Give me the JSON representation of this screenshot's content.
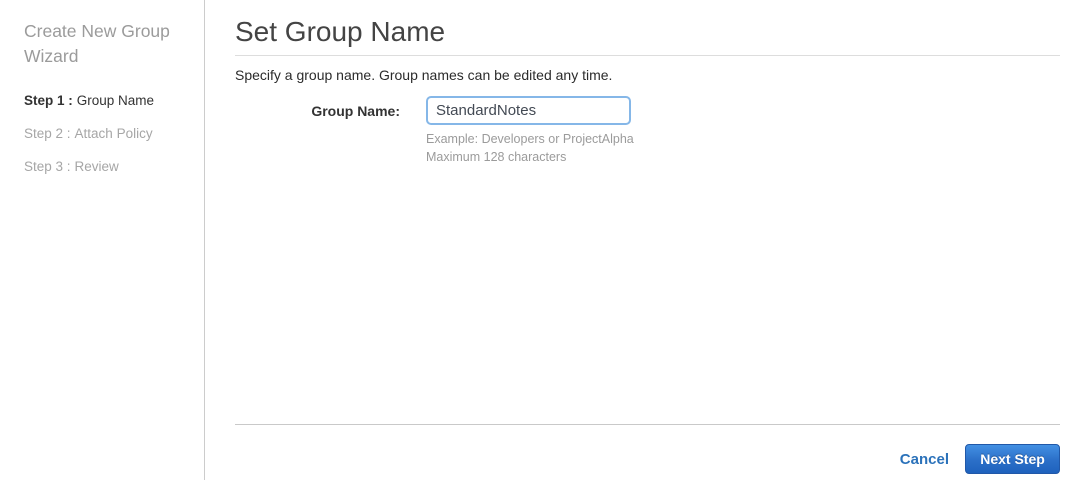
{
  "sidebar": {
    "title": "Create New Group Wizard",
    "steps": [
      {
        "prefix": "Step 1 :",
        "label": "Group Name",
        "active": true
      },
      {
        "prefix": "Step 2 :",
        "label": "Attach Policy",
        "active": false
      },
      {
        "prefix": "Step 3 :",
        "label": "Review",
        "active": false
      }
    ]
  },
  "main": {
    "title": "Set Group Name",
    "subtitle": "Specify a group name. Group names can be edited any time.",
    "form": {
      "group_name_label": "Group Name:",
      "group_name_value": "StandardNotes",
      "helper_line1": "Example: Developers or ProjectAlpha",
      "helper_line2": "Maximum 128 characters"
    },
    "footer": {
      "cancel_label": "Cancel",
      "next_label": "Next Step"
    }
  },
  "colors": {
    "accent_blue": "#2b72ba",
    "button_gradient_top": "#4390e3",
    "button_gradient_bottom": "#1f62bd",
    "input_focus_border": "#85b7e8",
    "muted_gray": "#9b9b9b",
    "heading_gray": "#444444",
    "divider_gray": "#c9c9c9"
  }
}
